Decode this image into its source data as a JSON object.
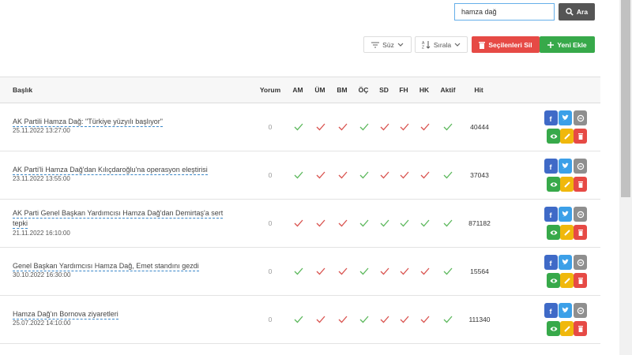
{
  "search": {
    "value": "hamza dağ",
    "button_label": "Ara"
  },
  "toolbar": {
    "filter_label": "Süz",
    "sort_label": "Sırala",
    "delete_selected_label": "Seçilenleri Sil",
    "add_new_label": "Yeni Ekle"
  },
  "table": {
    "headers": {
      "title": "Başlık",
      "comments": "Yorum",
      "am": "AM",
      "um": "ÜM",
      "bm": "BM",
      "oc": "ÖÇ",
      "sd": "SD",
      "fh": "FH",
      "hk": "HK",
      "active": "Aktif",
      "hit": "Hit"
    },
    "rows": [
      {
        "title_line1": "AK Partili Hamza Dağ: \"Türkiye yüzyılı başlıyor\"",
        "title_line2": "",
        "date": "25.11.2022 13:27:00",
        "comments": "0",
        "flags": [
          "green",
          "red",
          "red",
          "green",
          "red",
          "red",
          "red",
          "green"
        ],
        "hit": "40444"
      },
      {
        "title_line1": "AK Parti'li Hamza Dağ'dan Kılıçdaroğlu'na operasyon eleştirisi",
        "title_line2": "",
        "date": "23.11.2022 13:55:00",
        "comments": "0",
        "flags": [
          "green",
          "red",
          "red",
          "green",
          "red",
          "red",
          "red",
          "green"
        ],
        "hit": "37043"
      },
      {
        "title_line1": "AK Parti Genel Başkan Yardımcısı Hamza Dağ'dan Demirtaş'a sert",
        "title_line2": "tepki",
        "date": "21.11.2022 16:10:00",
        "comments": "0",
        "flags": [
          "red",
          "red",
          "red",
          "green",
          "green",
          "green",
          "green",
          "green"
        ],
        "hit": "871182"
      },
      {
        "title_line1": "Genel Başkan Yardımcısı Hamza Dağ, Emet standını gezdi",
        "title_line2": "",
        "date": "30.10.2022 16:30:00",
        "comments": "0",
        "flags": [
          "green",
          "red",
          "red",
          "green",
          "red",
          "red",
          "red",
          "green"
        ],
        "hit": "15564"
      },
      {
        "title_line1": "Hamza Dağ'ın Bornova ziyaretleri",
        "title_line2": "",
        "date": "25.07.2022 14:10:00",
        "comments": "0",
        "flags": [
          "green",
          "red",
          "red",
          "green",
          "red",
          "red",
          "red",
          "green"
        ],
        "hit": "111340"
      }
    ]
  },
  "colors": {
    "check_green": "#5cb85c",
    "check_red": "#d9534f",
    "delete_red": "#e64a45",
    "add_green": "#37a94a",
    "facebook": "#3f6ac7",
    "twitter": "#3ca0e8",
    "link_gray": "#8f8f8f",
    "view_green": "#37a94a",
    "edit_yellow": "#f0b80c"
  },
  "icons": {
    "search": "magnifier-icon",
    "filter": "filter-lines-icon",
    "sort": "sort-az-icon",
    "delete": "trash-icon",
    "add": "plus-icon",
    "row_actions": [
      "facebook-icon",
      "twitter-icon",
      "link-icon",
      "eye-icon",
      "pencil-icon",
      "trash-icon"
    ]
  }
}
